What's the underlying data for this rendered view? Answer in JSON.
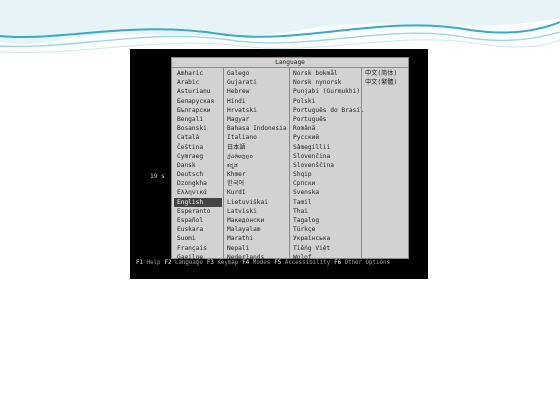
{
  "colors": {
    "terminal_bg": "#000000",
    "dialog_bg": "#d2d2d2",
    "selection_bg": "#444444",
    "wave_primary": "#3aa8c8",
    "wave_secondary": "#9ed6e6"
  },
  "dialog": {
    "title": "Language",
    "columns": [
      {
        "items": [
          "Amharic",
          "Arabic",
          "Asturianu",
          "Беларуская",
          "Български",
          "Bengali",
          "Bosanski",
          "Català",
          "Čeština",
          "Cymraeg",
          "Dansk",
          "Deutsch",
          "Dzongkha",
          "Ελληνικά",
          "English",
          "Esperanto",
          "Español",
          "Euskara",
          "Suomi",
          "Français",
          "Gaeilge"
        ]
      },
      {
        "items": [
          "Galego",
          "Gujarati",
          "Hebrew",
          "Hindi",
          "Hrvatski",
          "Magyar",
          "Bahasa Indonesia",
          "Italiano",
          "日本語",
          "ქართული",
          "ಕನ್ನಡ",
          "Khmer",
          "한국어",
          "Kurdî",
          "Lietuviškai",
          "Latviski",
          "Македонски",
          "Malayalam",
          "Marathi",
          "Nepali",
          "Nederlands"
        ]
      },
      {
        "items": [
          "Norsk bokmål",
          "Norsk nynorsk",
          "Punjabi (Gurmukhi)",
          "Polski",
          "Português do Brasil",
          "Português",
          "Română",
          "Русский",
          "Sâmegillii",
          "Slovenčina",
          "Slovenščina",
          "Shqip",
          "Српски",
          "Svenska",
          "Tamil",
          "Thai",
          "Tagalog",
          "Türkçe",
          "Українська",
          "Tiếng Việt",
          "Wolof"
        ]
      },
      {
        "items": [
          "中文(简体)",
          "中文(繁體)"
        ]
      }
    ],
    "selected": "English"
  },
  "timer": {
    "text": "19 s"
  },
  "function_keys": [
    {
      "key": "F1",
      "label": "Help"
    },
    {
      "key": "F2",
      "label": "Language"
    },
    {
      "key": "F3",
      "label": "Keymap"
    },
    {
      "key": "F4",
      "label": "Modes"
    },
    {
      "key": "F5",
      "label": "Accessibility"
    },
    {
      "key": "F6",
      "label": "Other Options"
    }
  ]
}
